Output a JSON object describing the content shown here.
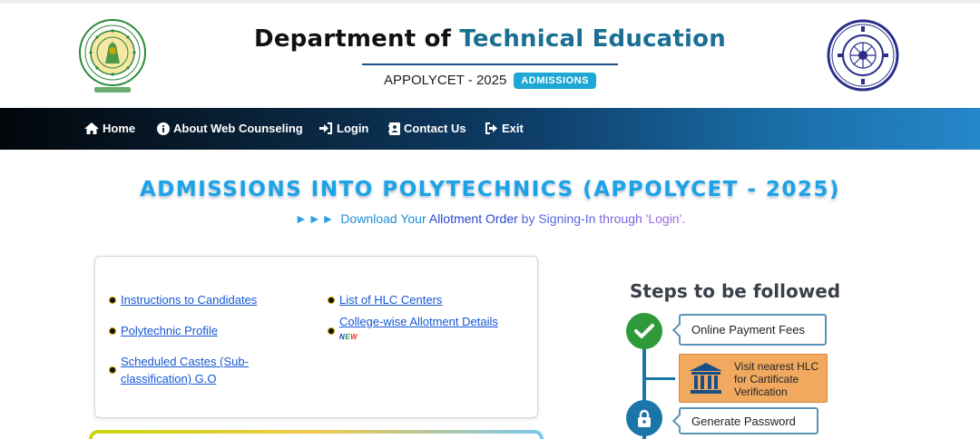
{
  "header": {
    "title_part1": "Department of ",
    "title_part2": "Technical Education",
    "exam": "APPOLYCET - 2025",
    "badge": "ADMISSIONS",
    "accent_color": "#1b6f94"
  },
  "nav": {
    "items": [
      {
        "label": "Home",
        "icon": "home-icon"
      },
      {
        "label": "About Web Counseling",
        "icon": "info-icon"
      },
      {
        "label": "Login",
        "icon": "login-icon"
      },
      {
        "label": "Contact Us",
        "icon": "contact-card-icon"
      },
      {
        "label": "Exit",
        "icon": "exit-icon"
      }
    ]
  },
  "main": {
    "title": "ADMISSIONS INTO POLYTECHNICS (APPOLYCET - 2025)",
    "marquee": {
      "arrows": "►►►",
      "p1": "Download Your ",
      "p2": "Allotment Order",
      "p3": " by Signing-In",
      "p4": " through ",
      "p5": "'Login'."
    }
  },
  "links": {
    "left": [
      "Instructions to Candidates",
      "Polytechnic Profile",
      "Scheduled Castes (Sub-classification) G.O"
    ],
    "right": [
      "List of HLC Centers",
      "College-wise Allotment Details"
    ],
    "new_badge": [
      "N",
      "E",
      "W"
    ]
  },
  "steps": {
    "title": "Steps to be followed",
    "items": [
      "Online Payment Fees",
      "Visit nearest HLC for Cartificate Verification",
      "Generate Password"
    ],
    "step2_lines": [
      "Visit nearest HLC",
      "for Cartificate",
      "Verification"
    ]
  },
  "colors": {
    "nav_dark": "#02060a",
    "nav_light": "#2587c9",
    "title_blue": "#1ca3e6",
    "link_blue": "#1458d6",
    "step_green": "#2f9a3a",
    "step_orange": "#f0a95f"
  }
}
